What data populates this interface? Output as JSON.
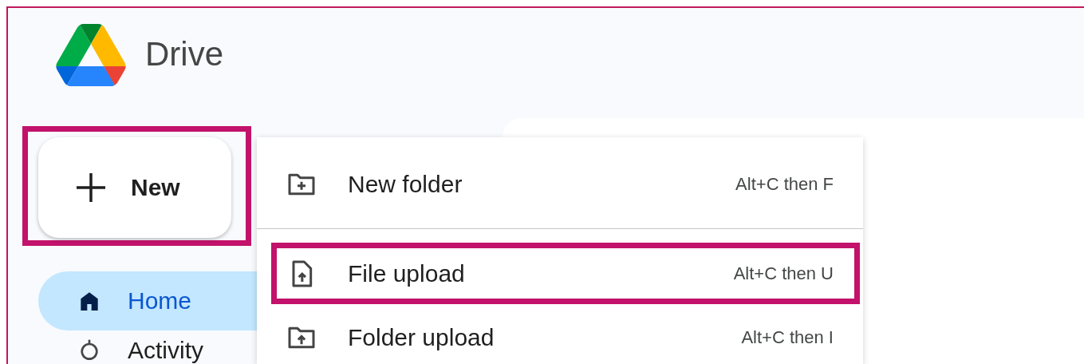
{
  "app": {
    "name": "Drive"
  },
  "new_button": {
    "label": "New",
    "highlighted": true
  },
  "sidebar": {
    "items": [
      {
        "label": "Home",
        "selected": true
      },
      {
        "label": "Activity",
        "selected": false
      }
    ]
  },
  "new_menu": {
    "items": [
      {
        "label": "New folder",
        "shortcut": "Alt+C then F",
        "highlighted": false,
        "divider_after": true
      },
      {
        "label": "File upload",
        "shortcut": "Alt+C then U",
        "highlighted": true,
        "divider_after": false
      },
      {
        "label": "Folder upload",
        "shortcut": "Alt+C then I",
        "highlighted": false,
        "divider_after": false
      }
    ]
  }
}
